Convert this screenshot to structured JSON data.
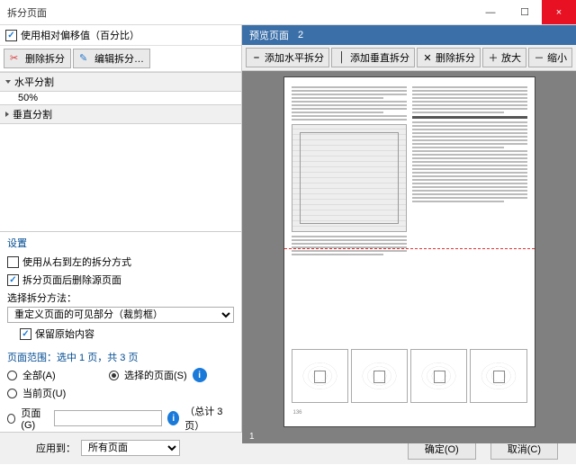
{
  "window": {
    "title": "拆分页面",
    "minimize": "—",
    "maximize": "☐",
    "close": "×"
  },
  "left": {
    "use_relative_offset_label": "使用相对偏移值（百分比）",
    "delete_split": "删除拆分",
    "edit_split": "编辑拆分…",
    "horiz_section": "水平分割",
    "horiz_pct": "50%",
    "vert_section": "垂直分割"
  },
  "settings": {
    "title": "设置",
    "rtl_label": "使用从右到左的拆分方式",
    "delete_src_label": "拆分页面后删除源页面",
    "method_label": "选择拆分方法：",
    "method_value": "重定义页面的可见部分（裁剪框）",
    "keep_original_label": "保留原始内容"
  },
  "scope": {
    "title": "页面范围：选中 1 页，共 3 页",
    "all": "全部(A)",
    "selected": "选择的页面(S)",
    "current": "当前页(U)",
    "pages": "页面(G)",
    "total": "（总计 3 页）",
    "apply_label": "应用到：",
    "apply_value": "所有页面"
  },
  "preview": {
    "header": "预览页面",
    "page_index": "2",
    "add_horiz": "添加水平拆分",
    "add_vert": "添加垂直拆分",
    "del_split": "删除拆分",
    "zoom_in": "放大",
    "zoom_out": "缩小",
    "page_num_label": "1",
    "doc_page_footer": "136"
  },
  "footer": {
    "ok": "确定(O)",
    "cancel": "取消(C)"
  }
}
